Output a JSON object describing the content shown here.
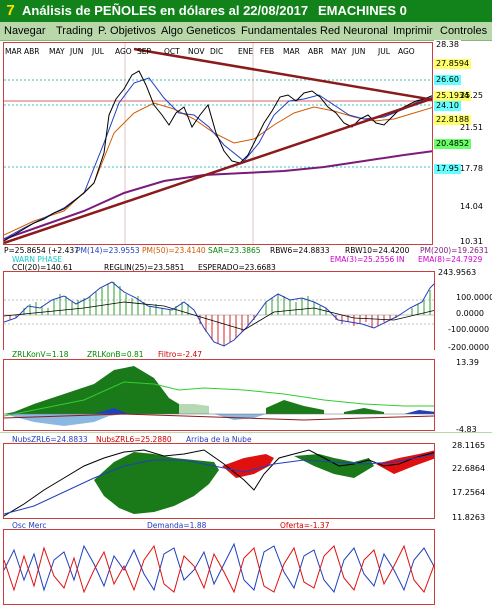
{
  "window": {
    "title": "Análisis de PEÑOLES en dólares al 22/08/2017",
    "subtitle": "EMACHINES 0",
    "logo_glyph": "7"
  },
  "menu": {
    "items": [
      "Navegar",
      "Trading",
      "P. Objetivos",
      "Algo Geneticos",
      "Fundamentales",
      "Red Neuronal",
      "Imprimir",
      "Controles"
    ]
  },
  "price_panel": {
    "months": [
      "MAR",
      "ABR",
      "MAY",
      "JUN",
      "JUL",
      "AGO",
      "SEP",
      "OCT",
      "NOV",
      "DIC",
      "ENE",
      "FEB",
      "MAR",
      "ABR",
      "MAY",
      "JUN",
      "JUL",
      "AGO"
    ],
    "y_ticks": [
      "28.38",
      "25.25",
      "21.51",
      "17.78",
      "14.04",
      "10.31"
    ],
    "badges": [
      {
        "text": "28.38",
        "color": "#000000",
        "bg": "#ffffff"
      },
      {
        "text": "27.8594",
        "color": "#000000",
        "bg": "#ffff66"
      },
      {
        "text": "26.60",
        "color": "#000000",
        "bg": "#66ffff"
      },
      {
        "text": "25.1934",
        "color": "#000000",
        "bg": "#ffff66"
      },
      {
        "text": "24.10",
        "color": "#000000",
        "bg": "#66ffff"
      },
      {
        "text": "22.8188",
        "color": "#000000",
        "bg": "#ffff66"
      },
      {
        "text": "20.4852",
        "color": "#000000",
        "bg": "#66ff66"
      },
      {
        "text": "17.95",
        "color": "#000000",
        "bg": "#66ffff"
      }
    ],
    "legend": [
      {
        "text": "P=25.8654 (+2.437",
        "color": "#000000"
      },
      {
        "text": "PM(14)=23.9553",
        "color": "#1f3fbf"
      },
      {
        "text": "PM(50)=23.4140",
        "color": "#d45a00"
      },
      {
        "text": "SAR=23.3865",
        "color": "#008800"
      },
      {
        "text": "RBW6=24.8833",
        "color": "#000000"
      },
      {
        "text": "RBW10=24.4200",
        "color": "#000000"
      },
      {
        "text": "PM(200)=19.2631",
        "color": "#7a1b7a"
      },
      {
        "text": "WARN PHASE",
        "color": "#19c8c8"
      },
      {
        "text": "EMA(3)=25.2556 IN",
        "color": "#cc00cc"
      },
      {
        "text": "EMA(8)=24.7929",
        "color": "#cc00cc"
      }
    ]
  },
  "cci_panel": {
    "labels": [
      {
        "text": "CCI(20)=140.61",
        "color": "#000000"
      },
      {
        "text": "REGLIN(25)=23.5851",
        "color": "#000000"
      },
      {
        "text": "ESPERADO=23.6683",
        "color": "#000000"
      }
    ],
    "y_ticks": [
      "243.9563",
      "100.0000",
      "0.0000",
      "-100.0000",
      "-200.0000"
    ]
  },
  "zrl_panel": {
    "labels": [
      {
        "text": "ZRLKonV=1.18",
        "color": "#008800"
      },
      {
        "text": "ZRLKonB=0.81",
        "color": "#008800"
      },
      {
        "text": "Filtro=-2.47",
        "color": "#cc0000"
      }
    ],
    "y_ticks": [
      "13.39",
      "-4.83"
    ]
  },
  "nubes_panel": {
    "labels": [
      {
        "text": "NubsZRL6=24.8833",
        "color": "#1f3fbf"
      },
      {
        "text": "NubsZRL6=25.2880",
        "color": "#cc0000"
      },
      {
        "text": "Arriba de la Nube",
        "color": "#1f3fbf"
      }
    ],
    "y_ticks": [
      "28.1165",
      "22.6864",
      "17.2564",
      "11.8263"
    ]
  },
  "osc_panel": {
    "labels": [
      {
        "text": "Osc Merc",
        "color": "#1f3fbf"
      },
      {
        "text": "Demanda=1.88",
        "color": "#1f3fbf"
      },
      {
        "text": "Oferta=-1.37",
        "color": "#cc0000"
      }
    ]
  }
}
